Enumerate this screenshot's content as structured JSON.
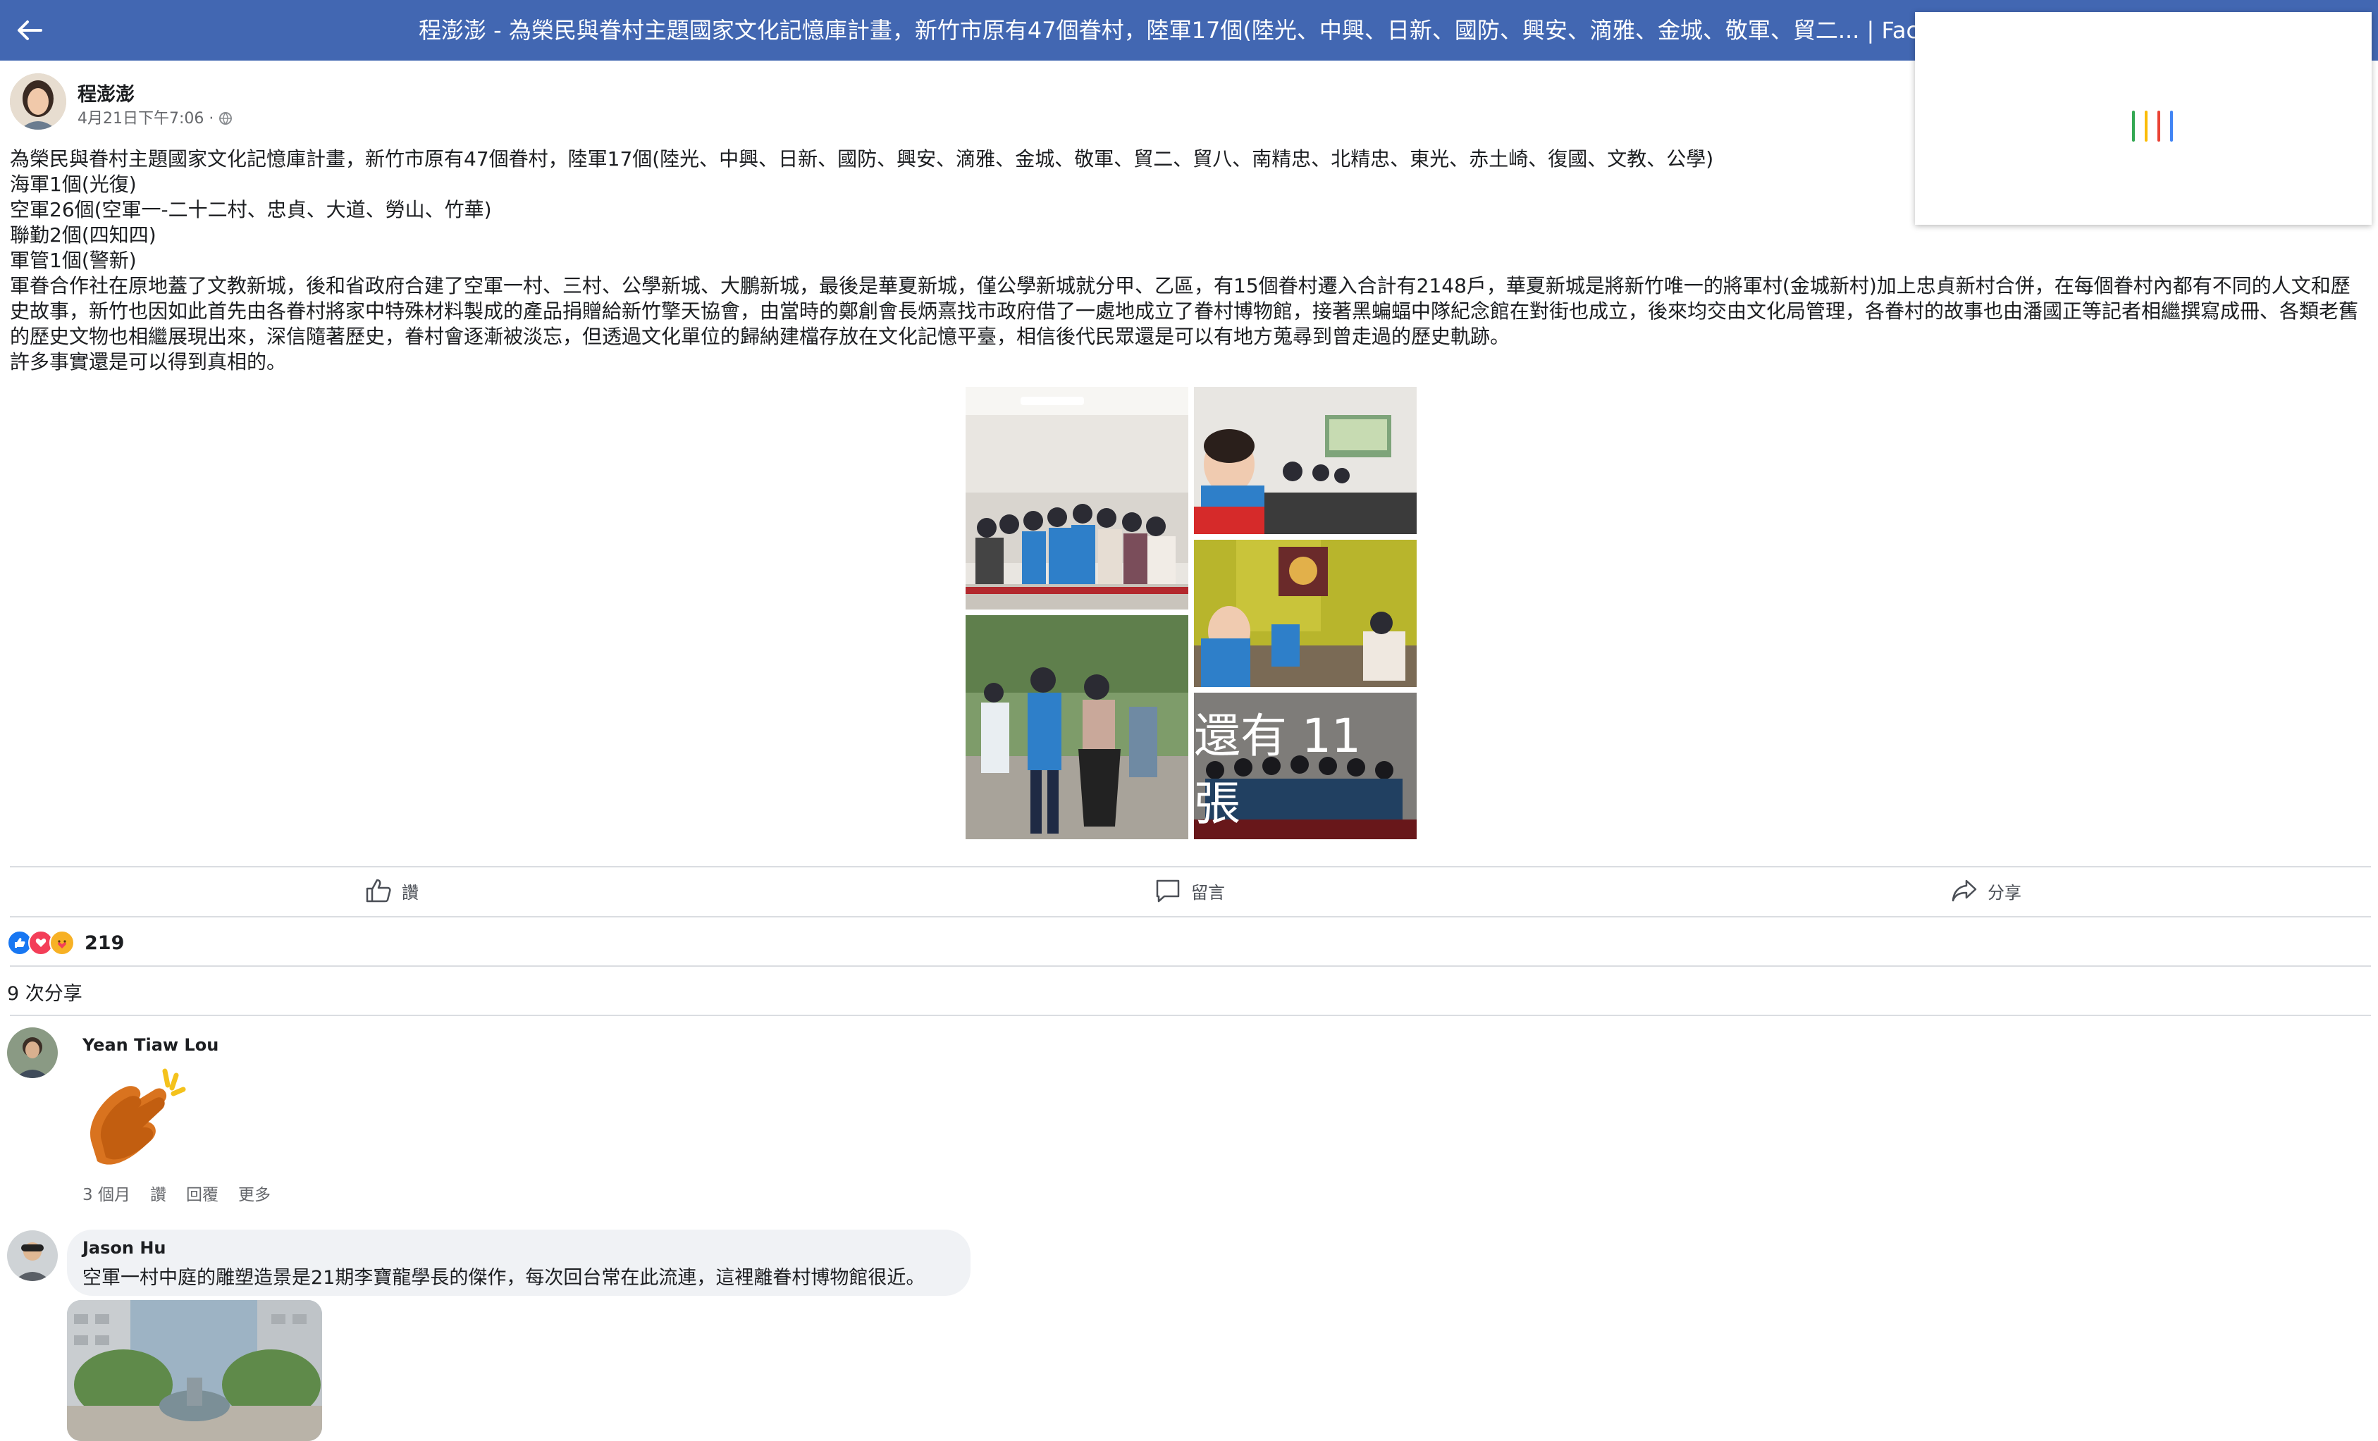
{
  "colors": {
    "topbar": "#4267b2",
    "like_blue": "#1877f2",
    "love_red": "#f33e58",
    "care_yellow": "#f7b125"
  },
  "topbar": {
    "back_icon": "arrow-left-icon",
    "title": "程澎澎 - 為榮民與眷村主題國家文化記憶庫計畫，新竹市原有47個眷村，陸軍17個(陸光、中興、日新、國防、興安、滴雅、金城、敬軍、貿二... | Face"
  },
  "popup": {
    "state": "loading"
  },
  "post": {
    "author": "程澎澎",
    "meta": "4月21日下午7:06 · ",
    "privacy_icon": "globe-icon",
    "body": [
      "為榮民與眷村主題國家文化記憶庫計畫，新竹市原有47個眷村，陸軍17個(陸光、中興、日新、國防、興安、滴雅、金城、敬軍、貿二、貿八、南精忠、北精忠、東光、赤土崎、復國、文教、公學)",
      "海軍1個(光復)",
      "空軍26個(空軍一-二十二村、忠貞、大道、勞山、竹華)",
      "聯勤2個(四知四)",
      "軍管1個(警新)",
      "軍眷合作社在原地蓋了文教新城，後和省政府合建了空軍一村、三村、公學新城、大鵬新城，最後是華夏新城，僅公學新城就分甲、乙區，有15個眷村遷入合計有2148戶，華夏新城是將新竹唯一的將軍村(金城新村)加上忠貞新村合併，在每個眷村內都有不同的人文和歷史故事，新竹也因如此首先由各眷村將家中特殊材料製成的產品捐贈給新竹擎天協會，由當時的鄭創會長炳熹找市政府借了一處地成立了眷村博物館，接著黑蝙蝠中隊紀念館在對街也成立，後來均交由文化局管理，各眷村的故事也由潘國正等記者相繼撰寫成冊、各類老舊的歷史文物也相繼展現出來，深信隨著歷史，眷村會逐漸被淡忘，但透過文化單位的歸納建檔存放在文化記憶平臺，相信後代民眾還是可以有地方蒐尋到曾走過的歷史軌跡。",
      "許多事實還是可以得到真相的。"
    ],
    "photos_more": "還有 11 張",
    "actions": {
      "like": "讚",
      "comment": "留言",
      "share": "分享"
    },
    "reaction_icons": [
      "like-reaction-icon",
      "love-reaction-icon",
      "care-reaction-icon"
    ],
    "reaction_count": "219",
    "shares": "9 次分享"
  },
  "comments": [
    {
      "name": "Yean Tiaw Lou",
      "sticker": "clapping-hands-sticker",
      "time": "3 個月",
      "like": "讚",
      "reply": "回覆",
      "more": "更多"
    },
    {
      "name": "Jason Hu",
      "text": "空軍一村中庭的雕塑造景是21期李寶龍學長的傑作，每次回台常在此流連，這裡離眷村博物館很近。"
    }
  ]
}
